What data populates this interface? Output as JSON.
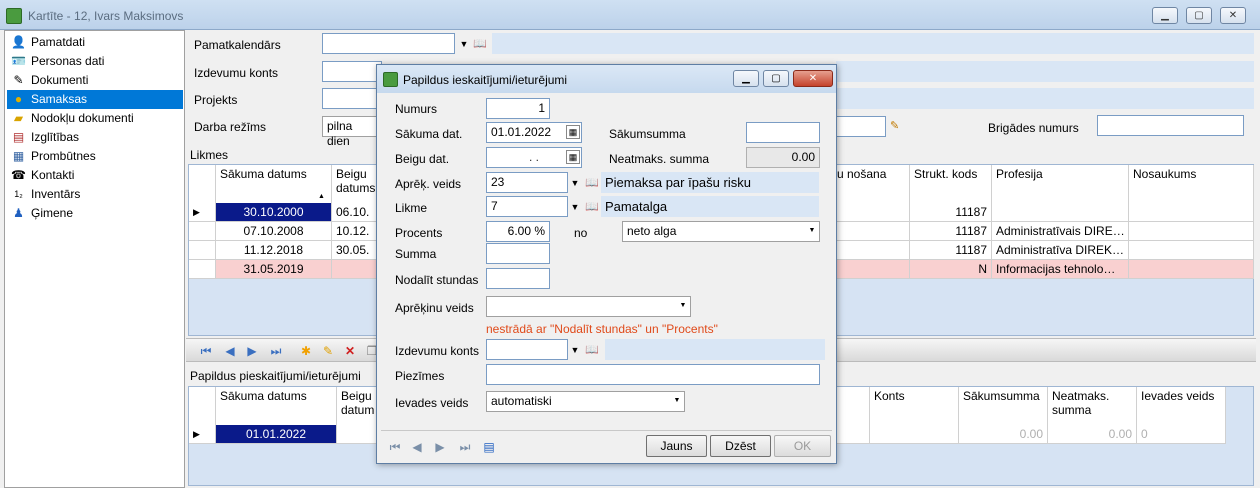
{
  "window": {
    "title": "Kartīte - 12, Ivars Maksimovs"
  },
  "sidebar": {
    "items": [
      {
        "label": "Pamatdati",
        "icon": "person-icon"
      },
      {
        "label": "Personas dati",
        "icon": "id-card-icon"
      },
      {
        "label": "Dokumenti",
        "icon": "document-icon"
      },
      {
        "label": "Samaksas",
        "icon": "coins-icon",
        "selected": true
      },
      {
        "label": "Nodokļu dokumenti",
        "icon": "folder-icon"
      },
      {
        "label": "Izglītības",
        "icon": "books-icon"
      },
      {
        "label": "Prombūtnes",
        "icon": "calendar-icon"
      },
      {
        "label": "Kontakti",
        "icon": "phone-icon"
      },
      {
        "label": "Inventārs",
        "icon": "numbered-list-icon"
      },
      {
        "label": "Ģimene",
        "icon": "family-icon"
      }
    ]
  },
  "form": {
    "pamatkalendars_label": "Pamatkalendārs",
    "izdevumu_konts_label": "Izdevumu konts",
    "projekts_label": "Projekts",
    "darba_rezims_label": "Darba režīms",
    "darba_rezims_value": "pilna dien",
    "brigades_label": "Brigādes numurs"
  },
  "likmes": {
    "title": "Likmes",
    "headers": [
      "Sākuma datums",
      "Beigu datums",
      "u nošana",
      "Strukt. kods",
      "Profesija",
      "Nosaukums"
    ],
    "rows": [
      {
        "start": "30.10.2000",
        "end": "06.10.",
        "kods": "11187",
        "profesija": "",
        "selected": true
      },
      {
        "start": "07.10.2008",
        "end": "10.12.",
        "kods": "11187",
        "profesija": "Administratīvais DIRE…"
      },
      {
        "start": "11.12.2018",
        "end": "30.05.",
        "kods": "11187",
        "profesija": "Administratīva DIREK…"
      },
      {
        "start": "31.05.2019",
        "end": "",
        "kods": "N",
        "profesija": "Informacijas tehnolo…",
        "pink": true
      }
    ]
  },
  "papildus": {
    "title": "Papildus pieskaitījumi/ieturējumi",
    "headers": [
      "Sākuma datums",
      "Beigu datum",
      "Konts",
      "Sākumsumma",
      "Neatmaks. summa",
      "Ievades veids"
    ],
    "row": {
      "start": "01.01.2022",
      "sakumsumma": "0.00",
      "neatmaks": "0.00",
      "ievades": "0"
    }
  },
  "dialog": {
    "title": "Papildus ieskaitījumi/ieturējumi",
    "numurs_label": "Numurs",
    "numurs_value": "1",
    "sakuma_label": "Sākuma dat.",
    "sakuma_value": "01.01.2022",
    "beigu_label": "Beigu dat.",
    "beigu_value": ". .",
    "sakumsumma_label": "Sākumsumma",
    "sakumsumma_value": "",
    "neatmaks_label": "Neatmaks. summa",
    "neatmaks_value": "0.00",
    "aprek_label": "Aprēķ. veids",
    "aprek_value": "23",
    "aprek_desc": "Piemaksa par īpašu risku",
    "likme_label": "Likme",
    "likme_value": "7",
    "likme_desc": "Pamatalga",
    "procents_label": "Procents",
    "procents_value": "6.00 %",
    "no_label": "no",
    "no_value": "neto alga",
    "summa_label": "Summa",
    "nodalit_label": "Nodalīt stundas",
    "aprekinu_veids_label": "Aprēķinu veids",
    "warning": "nestrādā ar \"Nodalīt stundas\" un \"Procents\"",
    "izdevumu_label": "Izdevumu konts",
    "piezimes_label": "Piezīmes",
    "ievades_label": "Ievades veids",
    "ievades_value": "automatiski",
    "btn_jauns": "Jauns",
    "btn_dzest": "Dzēst",
    "btn_ok": "OK"
  }
}
